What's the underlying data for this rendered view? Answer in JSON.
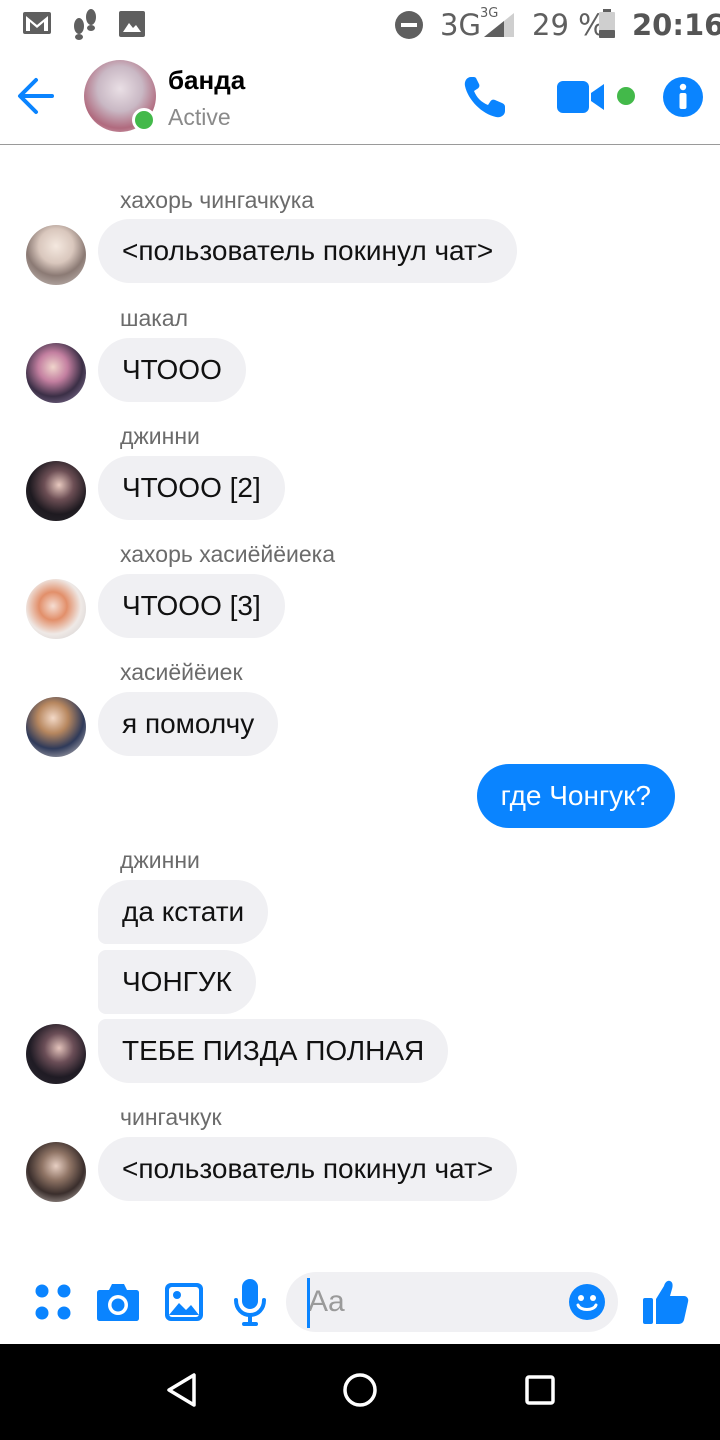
{
  "status_bar": {
    "network": "3G",
    "network_small": "3G",
    "battery": "29 %",
    "time": "20:16"
  },
  "header": {
    "title": "банда",
    "status": "Active"
  },
  "messages": [
    {
      "sender": "хахорь чингачкука",
      "text": "<пользователь покинул чат>"
    },
    {
      "sender": "шакал",
      "text": "ЧТООО"
    },
    {
      "sender": "джинни",
      "text": "ЧТООО [2]"
    },
    {
      "sender": "хахорь хасиёйёиека",
      "text": "ЧТООО [3]"
    },
    {
      "sender": "хасиёйёиек",
      "text": "я помолчу"
    },
    {
      "sender": "",
      "text": "где Чонгук?",
      "outgoing": true
    },
    {
      "sender": "джинни",
      "texts": [
        "да кстати",
        "ЧОНГУК",
        "ТЕБЕ ПИЗДА ПОЛНАЯ"
      ]
    },
    {
      "sender": "чингачкук",
      "text": "<пользователь покинул чат>"
    }
  ],
  "composer": {
    "placeholder": "Aa"
  },
  "colors": {
    "accent": "#0a84ff",
    "online": "#43b94a",
    "incoming_bubble": "#f0f0f3"
  }
}
